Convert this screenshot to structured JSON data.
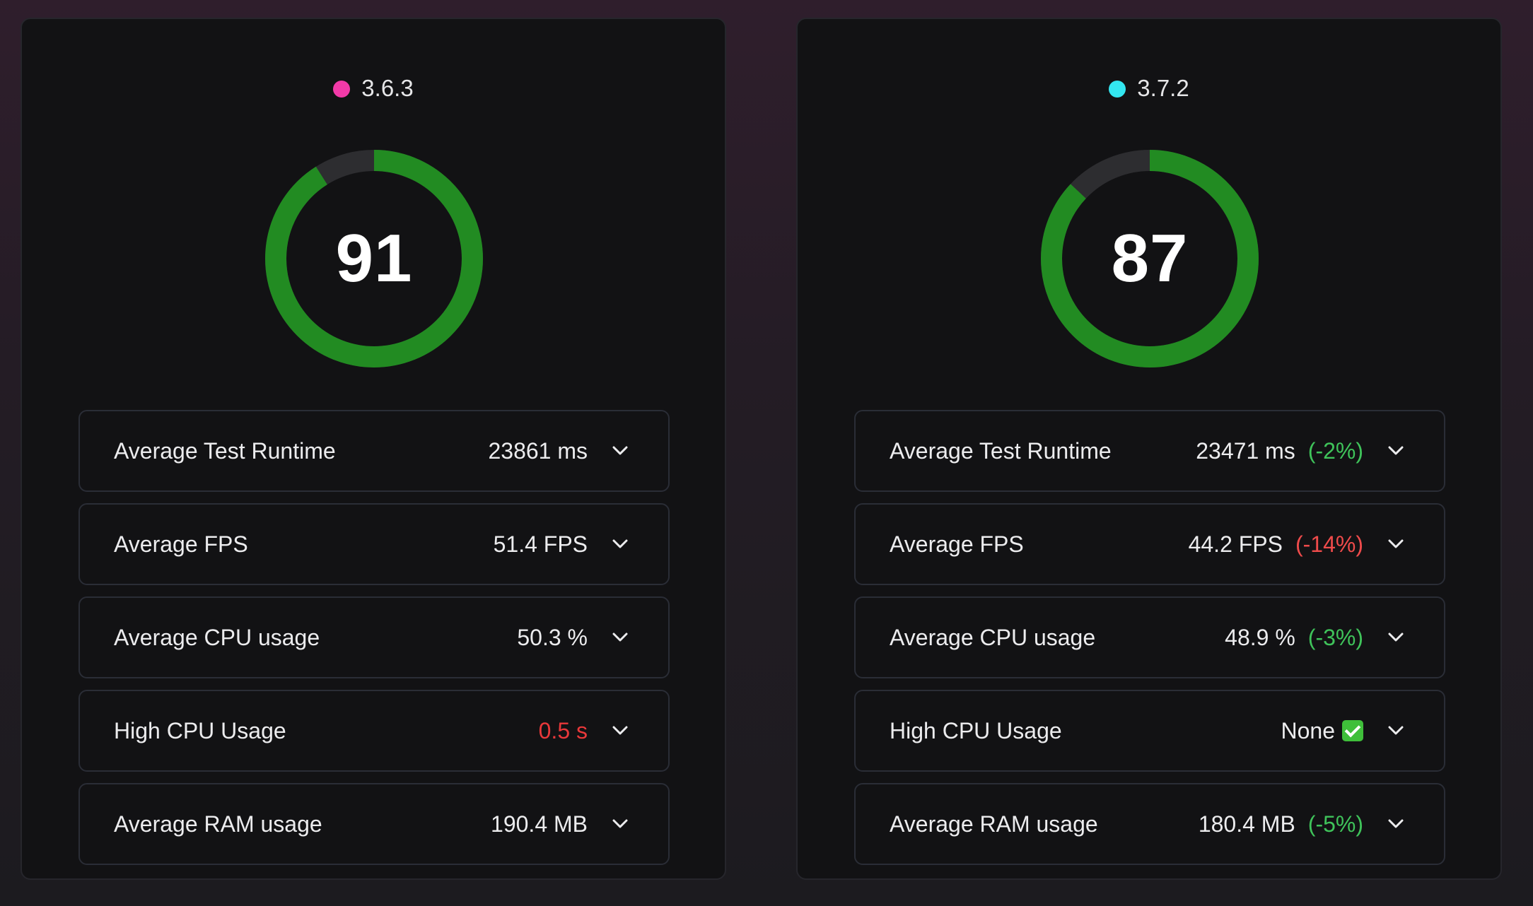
{
  "colors": {
    "gauge_fill": "#228b22",
    "gauge_track": "#2d2d30"
  },
  "panels": [
    {
      "version": "3.6.3",
      "dot_color": "#f23aa8",
      "score": "91",
      "score_fraction": 0.91,
      "metrics": [
        {
          "label": "Average Test Runtime",
          "value": "23861 ms",
          "delta": ""
        },
        {
          "label": "Average FPS",
          "value": "51.4 FPS",
          "delta": ""
        },
        {
          "label": "Average CPU usage",
          "value": "50.3 %",
          "delta": ""
        },
        {
          "label": "High CPU Usage",
          "value": "0.5 s",
          "delta": ""
        },
        {
          "label": "Average RAM usage",
          "value": "190.4 MB",
          "delta": ""
        }
      ]
    },
    {
      "version": "3.7.2",
      "dot_color": "#33e6f0",
      "score": "87",
      "score_fraction": 0.87,
      "metrics": [
        {
          "label": "Average Test Runtime",
          "value": "23471 ms",
          "delta": "(-2%)"
        },
        {
          "label": "Average FPS",
          "value": "44.2 FPS",
          "delta": "(-14%)"
        },
        {
          "label": "Average CPU usage",
          "value": "48.9 %",
          "delta": "(-3%)"
        },
        {
          "label": "High CPU Usage",
          "value": "None",
          "delta": ""
        },
        {
          "label": "Average RAM usage",
          "value": "180.4 MB",
          "delta": "(-5%)"
        }
      ]
    }
  ]
}
